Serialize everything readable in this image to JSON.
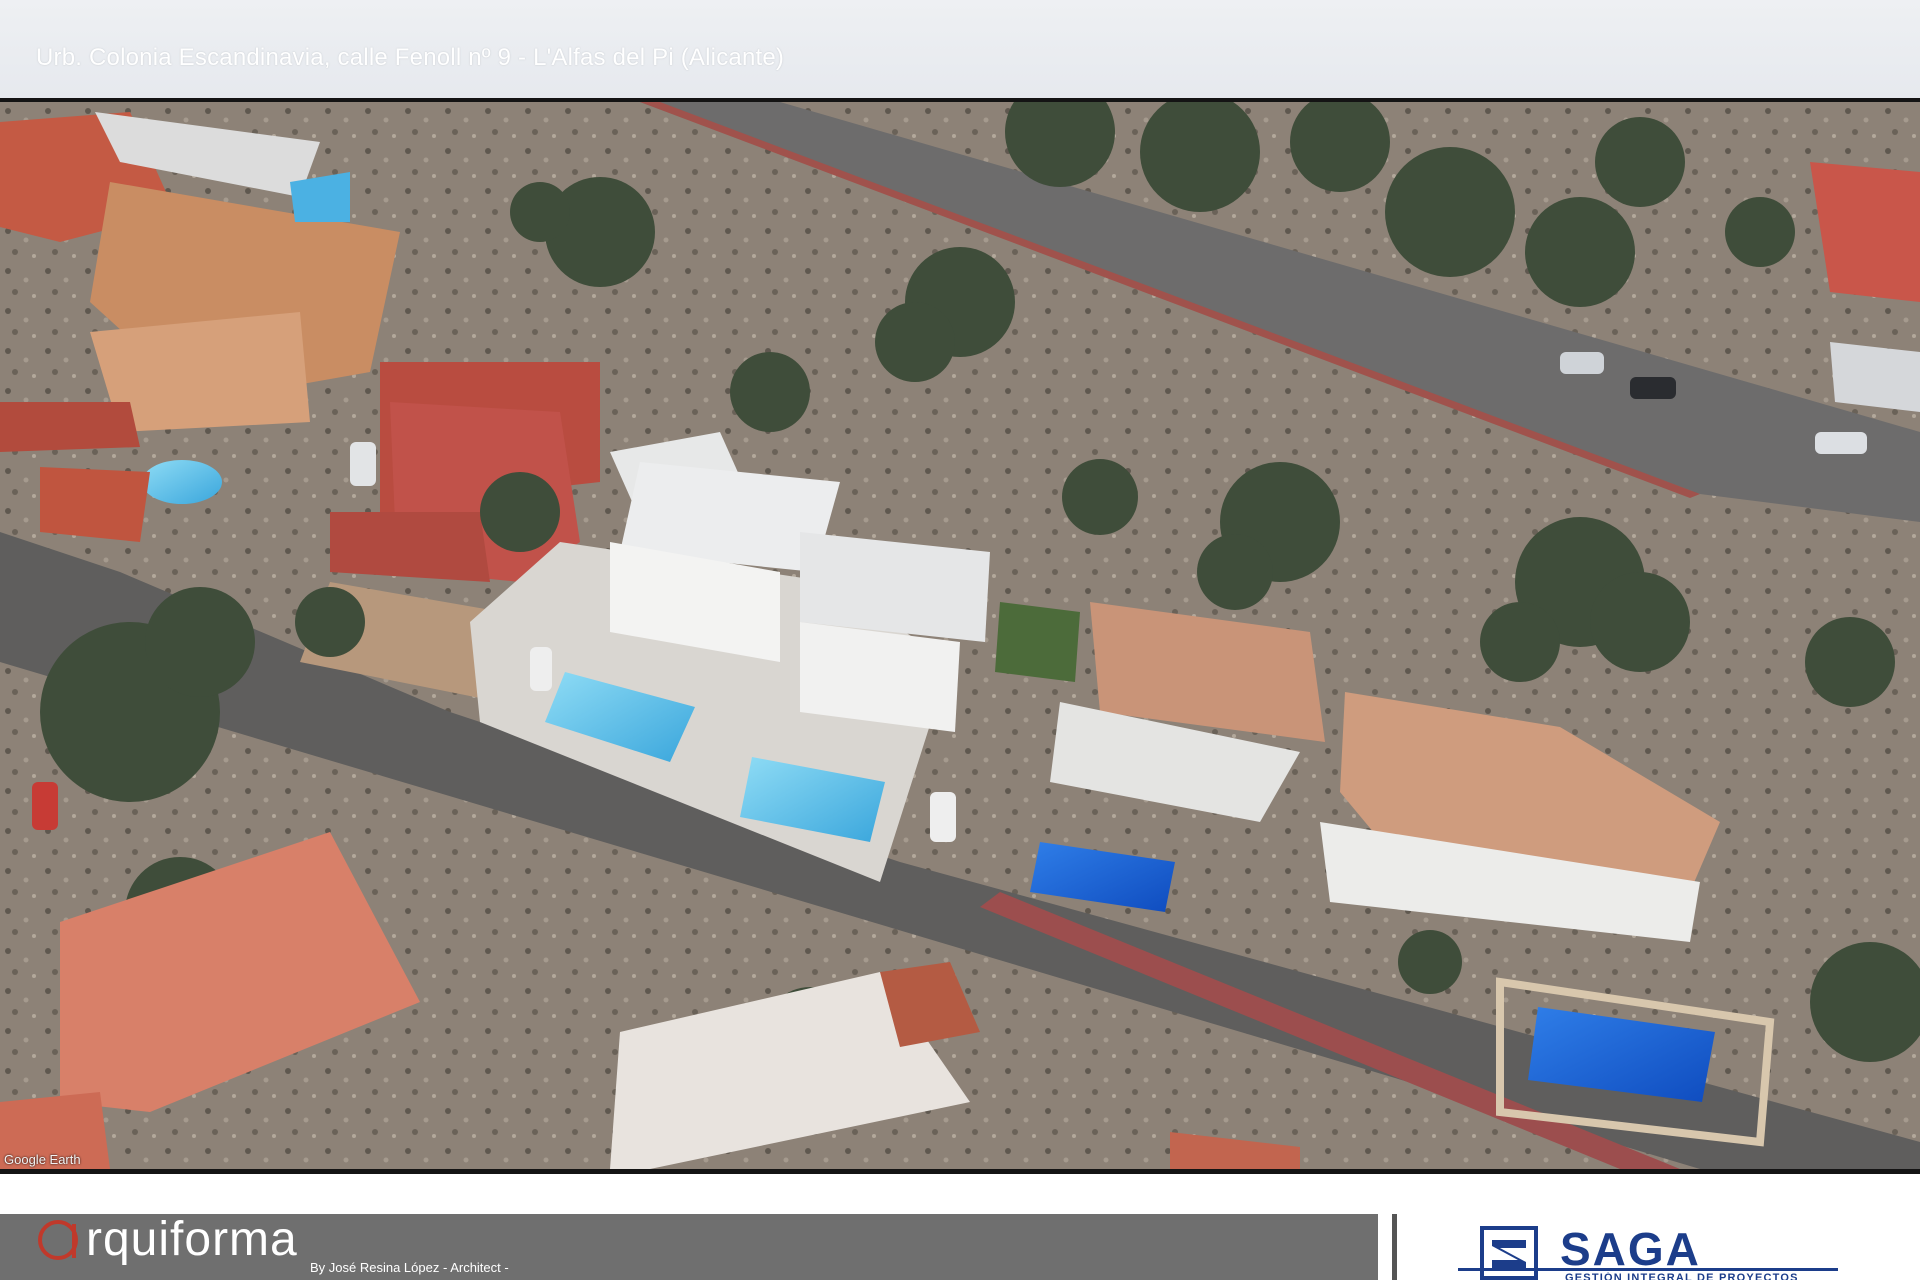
{
  "header": {
    "address": "Urb. Colonia Escandinavia, calle Fenoll nº 9 - L'Alfas del Pi (Alicante)"
  },
  "photo": {
    "description_icon": "aerial-photo",
    "watermark": "Google Earth"
  },
  "footer": {
    "brand_initial": "a",
    "brand_rest": "rquiforma",
    "brand_sub": "By José Resina López - Architect -",
    "brand_color": "#c0392b",
    "partner_name": "SAGA",
    "partner_sub": "GESTIÓN INTEGRAL DE PROYECTOS",
    "partner_color": "#1c3d8a"
  }
}
